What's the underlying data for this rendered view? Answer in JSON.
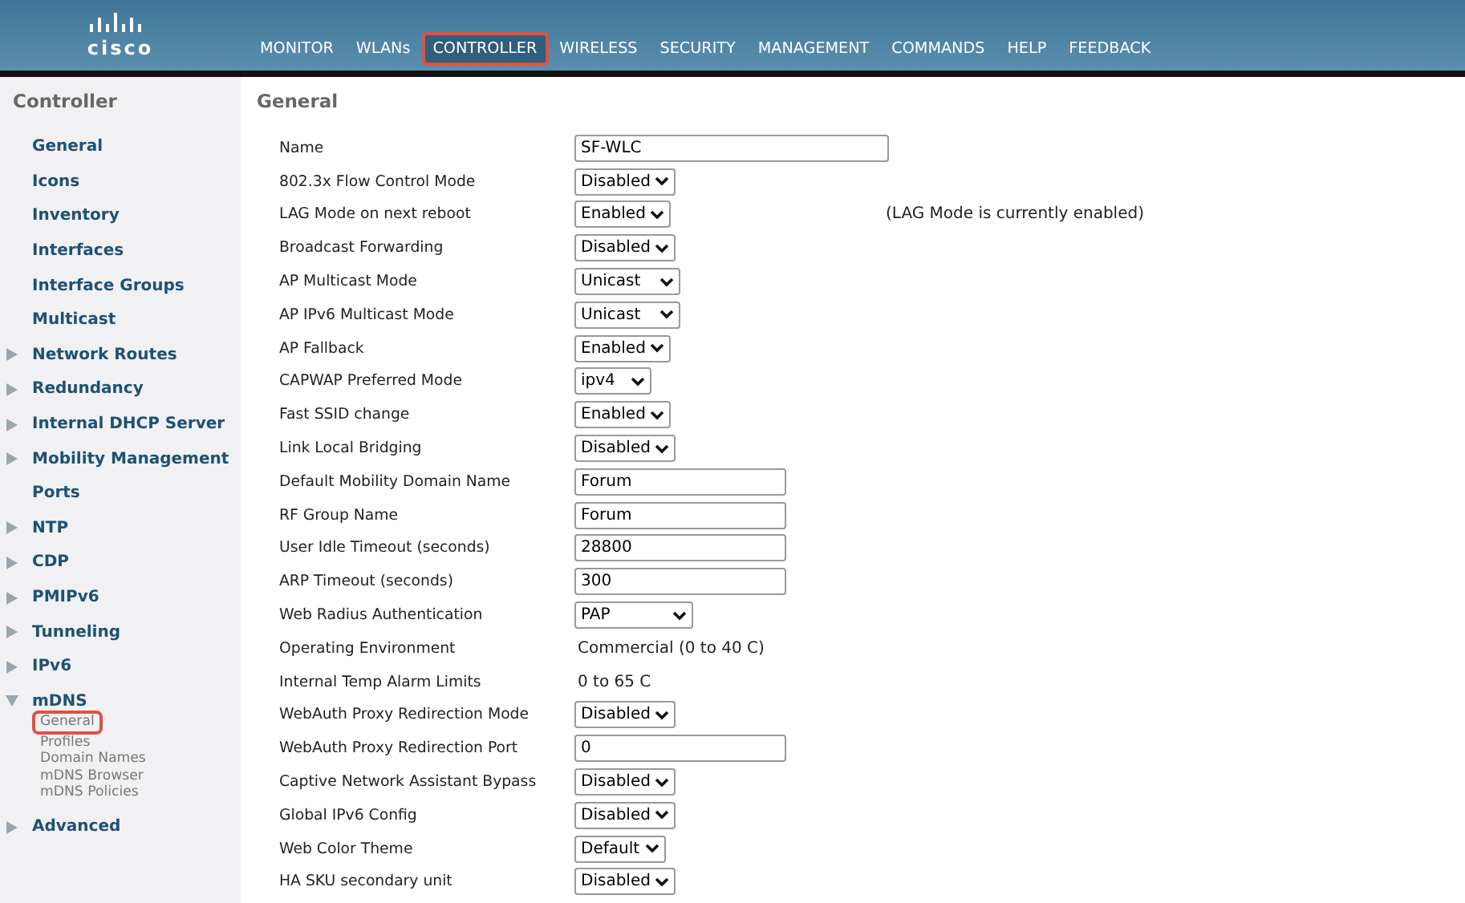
{
  "nav": [
    {
      "label": "MONITOR",
      "selected": false
    },
    {
      "label": "WLANs",
      "selected": false
    },
    {
      "label": "CONTROLLER",
      "selected": true
    },
    {
      "label": "WIRELESS",
      "selected": false
    },
    {
      "label": "SECURITY",
      "selected": false
    },
    {
      "label": "MANAGEMENT",
      "selected": false
    },
    {
      "label": "COMMANDS",
      "selected": false
    },
    {
      "label": "HELP",
      "selected": false
    },
    {
      "label": "FEEDBACK",
      "selected": false
    }
  ],
  "logo": "cisco",
  "sidebar": {
    "title": "Controller",
    "items": [
      {
        "label": "General"
      },
      {
        "label": "Icons"
      },
      {
        "label": "Inventory"
      },
      {
        "label": "Interfaces"
      },
      {
        "label": "Interface Groups"
      },
      {
        "label": "Multicast"
      },
      {
        "label": "Network Routes",
        "expanded": false
      },
      {
        "label": "Redundancy",
        "expanded": false
      },
      {
        "label": "Internal DHCP Server",
        "expanded": false
      },
      {
        "label": "Mobility Management",
        "expanded": false
      },
      {
        "label": "Ports"
      },
      {
        "label": "NTP",
        "expanded": false
      },
      {
        "label": "CDP",
        "expanded": false
      },
      {
        "label": "PMIPv6",
        "expanded": false
      },
      {
        "label": "Tunneling",
        "expanded": false
      },
      {
        "label": "IPv6",
        "expanded": false
      },
      {
        "label": "mDNS",
        "expanded": true,
        "children": [
          {
            "label": "General",
            "selected": true
          },
          {
            "label": "Profiles",
            "selected": false
          },
          {
            "label": "Domain Names",
            "selected": false
          },
          {
            "label": "mDNS Browser",
            "selected": false
          },
          {
            "label": "mDNS Policies",
            "selected": false
          }
        ]
      },
      {
        "label": "Advanced",
        "expanded": false
      }
    ]
  },
  "page_title": "General",
  "rows": [
    {
      "label": "Name",
      "kind": "wide_input",
      "value": "SF-WLC"
    },
    {
      "label": "802.3x Flow Control Mode",
      "kind": "select",
      "value": "Disabled"
    },
    {
      "label": "LAG Mode on next reboot",
      "kind": "select",
      "value": "Enabled",
      "note": "(LAG Mode is currently enabled)"
    },
    {
      "label": "Broadcast Forwarding",
      "kind": "select",
      "value": "Disabled"
    },
    {
      "label": "AP Multicast Mode",
      "kind": "select",
      "value": "Unicast"
    },
    {
      "label": "AP IPv6 Multicast Mode",
      "kind": "select",
      "value": "Unicast"
    },
    {
      "label": "AP Fallback",
      "kind": "select",
      "value": "Enabled"
    },
    {
      "label": "CAPWAP Preferred Mode",
      "kind": "select",
      "value": "ipv4"
    },
    {
      "label": "Fast SSID change",
      "kind": "select",
      "value": "Enabled"
    },
    {
      "label": "Link Local Bridging",
      "kind": "select",
      "value": "Disabled"
    },
    {
      "label": "Default Mobility Domain Name",
      "kind": "input",
      "value": "Forum"
    },
    {
      "label": "RF Group Name",
      "kind": "input",
      "value": "Forum"
    },
    {
      "label": "User Idle Timeout (seconds)",
      "kind": "input",
      "value": "28800"
    },
    {
      "label": "ARP Timeout (seconds)",
      "kind": "input",
      "value": "300"
    },
    {
      "label": "Web Radius Authentication",
      "kind": "select",
      "value": "PAP"
    },
    {
      "label": "Operating Environment",
      "kind": "text",
      "value": "Commercial (0 to 40 C)"
    },
    {
      "label": "Internal Temp Alarm Limits",
      "kind": "text",
      "value": "0 to 65 C"
    },
    {
      "label": "WebAuth Proxy Redirection Mode",
      "kind": "select",
      "value": "Disabled"
    },
    {
      "label": "WebAuth Proxy Redirection Port",
      "kind": "input",
      "value": "0"
    },
    {
      "label": "Captive Network Assistant Bypass",
      "kind": "select",
      "value": "Disabled"
    },
    {
      "label": "Global IPv6 Config",
      "kind": "select",
      "value": "Disabled"
    },
    {
      "label": "Web Color Theme",
      "kind": "select",
      "value": "Default"
    },
    {
      "label": "HA SKU secondary unit",
      "kind": "select",
      "value": "Disabled"
    }
  ]
}
